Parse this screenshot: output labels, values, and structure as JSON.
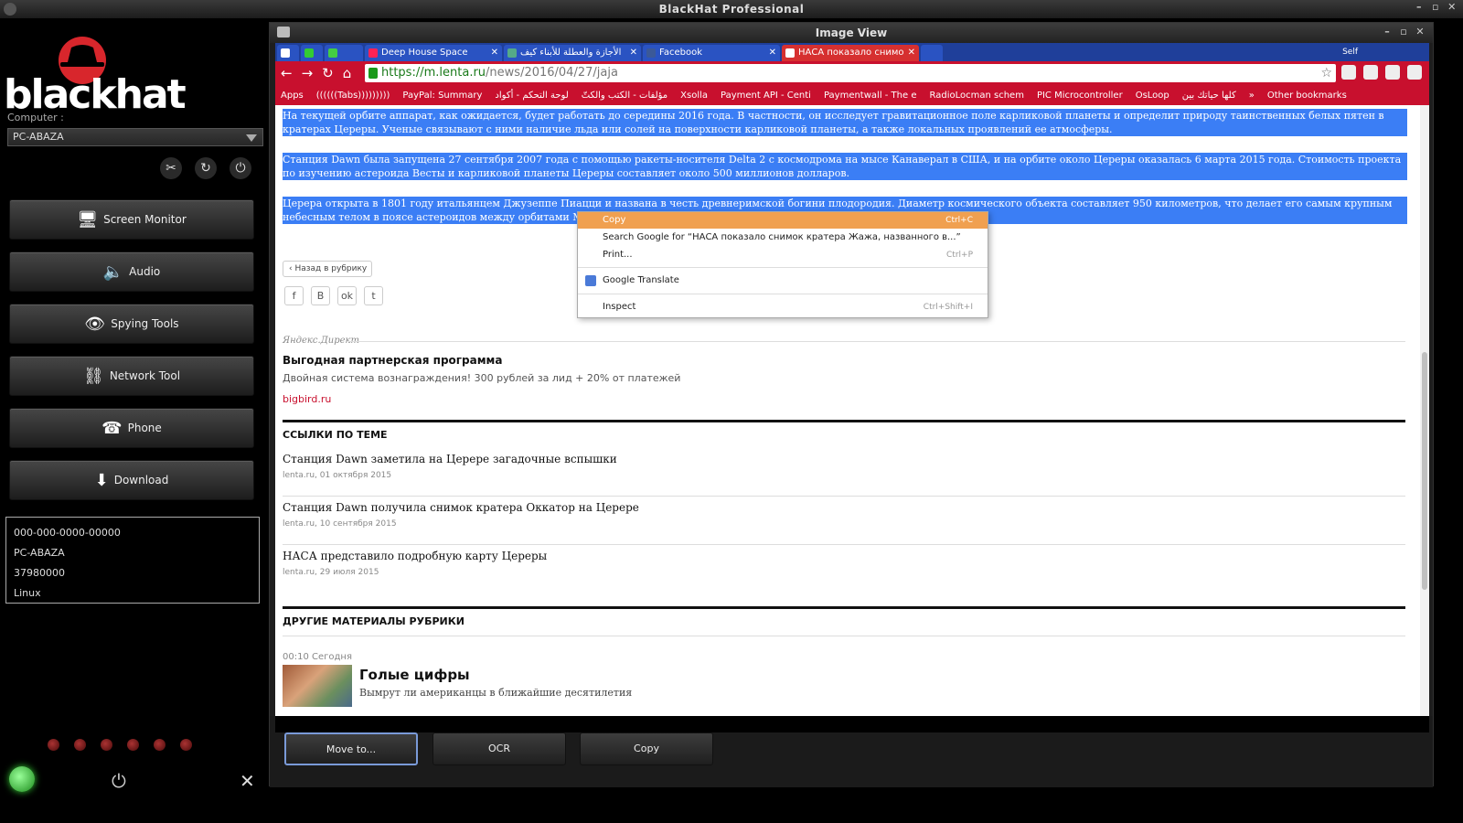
{
  "app": {
    "title": "BlackHat Professional"
  },
  "sidebar": {
    "logo_text": "blackhat",
    "computer_label": "Computer :",
    "computer_value": "PC-ABAZA",
    "buttons": [
      {
        "label": "Screen Monitor",
        "icon": "monitor-icon"
      },
      {
        "label": "Audio",
        "icon": "speaker-icon"
      },
      {
        "label": "Spying Tools",
        "icon": "eye-icon"
      },
      {
        "label": "Network Tool",
        "icon": "network-icon"
      },
      {
        "label": "Phone",
        "icon": "phone-icon"
      },
      {
        "label": "Download",
        "icon": "download-icon"
      }
    ],
    "info": [
      "000-000-0000-00000",
      "PC-ABAZA",
      "37980000",
      "Linux"
    ]
  },
  "image_view": {
    "title": "Image View",
    "buttons": {
      "move": "Move to...",
      "ocr": "OCR",
      "copy": "Copy"
    }
  },
  "browser": {
    "tabs": [
      {
        "label": "Deep House Space"
      },
      {
        "label": "الأجازة والعطلة للأبناء كيف"
      },
      {
        "label": "Facebook"
      },
      {
        "label": "НАСА показало снимо"
      }
    ],
    "profile": "Self",
    "url_scheme": "https://",
    "url_host": "m.lenta.ru",
    "url_path": "/news/2016/04/27/jaja",
    "bookmarks": [
      "Apps",
      "((((((Tabs)))))))))",
      "PayPal: Summary",
      "لوحة التحكم - أكواد",
      "مؤلفات - الكتب والكتّ",
      "Xsolla",
      "Payment API - Centi",
      "Paymentwall - The e",
      "RadioLocman schem",
      "PIC Microcontroller",
      "OsLoop",
      "كلها حياتك بين",
      "»",
      "Other bookmarks"
    ]
  },
  "page": {
    "p1": "На текущей орбите аппарат, как ожидается, будет работать до середины 2016 года. В частности, он исследует гравитационное поле карликовой планеты и определит природу таинственных белых пятен в кратерах Цереры. Ученые связывают с ними наличие льда или солей на поверхности карликовой планеты, а также локальных проявлений ее атмосферы.",
    "p2": "Станция Dawn была запущена 27 сентября 2007 года с помощью ракеты-носителя Delta 2 с космодрома на мысе Канаверал в США, и на орбите около Цереры оказалась 6 марта 2015 года. Стоимость проекта по изучению астероида Весты и карликовой планеты Цереры составляет около 500 миллионов долларов.",
    "p3": "Церера открыта в 1801 году итальянцем Джузеппе Пиацци и названа в честь древнеримской богини плодородия. Диаметр космического объекта составляет 950 километров, что делает его самым крупным небесным телом в поясе астероидов между орбитами Марса и Юпитера.",
    "back": "‹ Назад в рубрику",
    "direct": "Яндекс.Директ",
    "ad_title": "Выгодная партнерская программа",
    "ad_desc": "Двойная система вознаграждения! 300 рублей за лид + 20% от платежей",
    "ad_link": "bigbird.ru",
    "related_title": "ССЫЛКИ ПО ТЕМЕ",
    "related": [
      {
        "title": "Станция Dawn заметила на Церере загадочные вспышки",
        "date": "lenta.ru, 01 октября 2015"
      },
      {
        "title": "Станция Dawn получила снимок кратера Оккатор на Церере",
        "date": "lenta.ru, 10 сентября 2015"
      },
      {
        "title": "НАСА представило подробную карту Цереры",
        "date": "lenta.ru, 29 июля 2015"
      }
    ],
    "other_title": "ДРУГИЕ МАТЕРИАЛЫ РУБРИКИ",
    "other_time": "00:10 Сегодня",
    "other_headline": "Голые цифры",
    "other_desc": "Вымрут ли американцы в ближайшие десятилетия"
  },
  "context_menu": {
    "copy": "Copy",
    "copy_sc": "Ctrl+C",
    "search": "Search Google for “НАСА показало снимок кратера Жажа, названного в...”",
    "print": "Print...",
    "print_sc": "Ctrl+P",
    "translate": "Google Translate",
    "inspect": "Inspect",
    "inspect_sc": "Ctrl+Shift+I"
  },
  "colors": {
    "browser_red": "#c8102e",
    "tab_blue": "#1f3f9a",
    "selection": "#3b7ef5",
    "menu_hover": "#f0a050",
    "led_green": "#33cc33"
  }
}
